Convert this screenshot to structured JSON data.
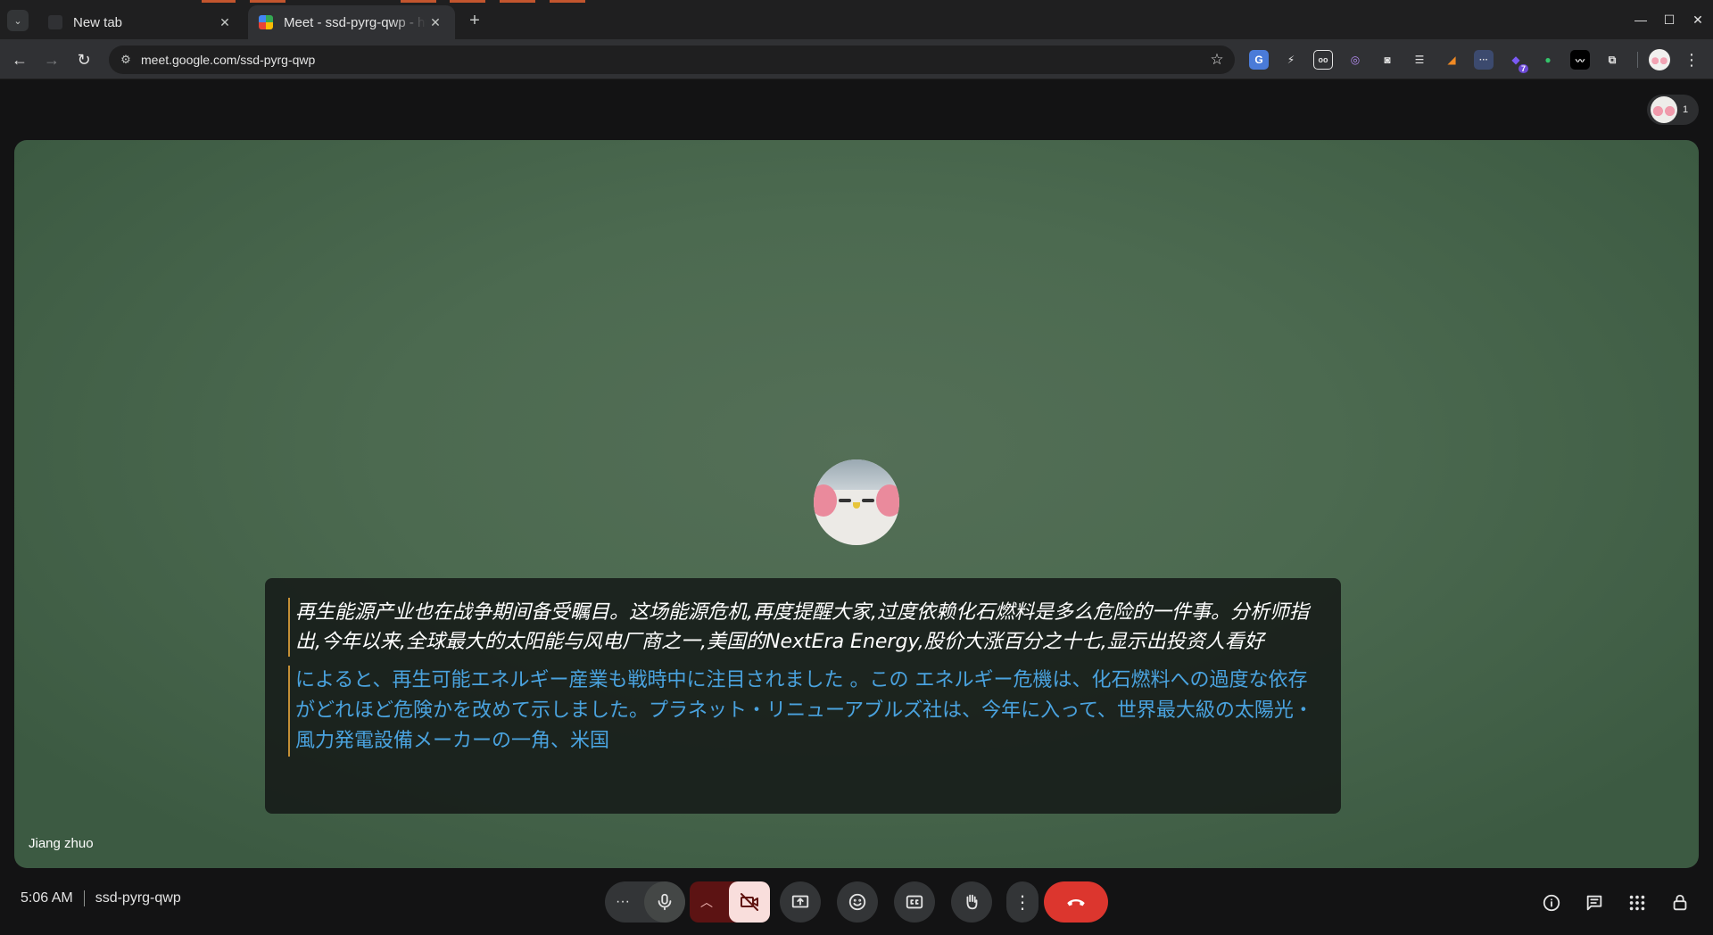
{
  "browser": {
    "tabs": [
      {
        "title": "New tab",
        "active": false
      },
      {
        "title": "Meet - ssd-pyrg-qwp - ht",
        "active": true
      }
    ],
    "url": "meet.google.com/ssd-pyrg-qwp",
    "extension_badge": "7"
  },
  "meet": {
    "participant_count": "1",
    "participant_name": "Jiang zhuo",
    "captions": {
      "chinese": "再生能源产业也在战争期间备受瞩目。这场能源危机,再度提醒大家,过度依赖化石燃料是多么危险的一件事。分析师指出,今年以来,全球最大的太阳能与风电厂商之一,美国的NextEra Energy,股价大涨百分之十七,显示出投资人看好",
      "japanese": "によると、再生可能エネルギー産業も戦時中に注目されました 。この エネルギー危機は、化石燃料への過度な依存がどれほど危険かを改めて示しました。プラネット・リニューアブルズ社は、今年に入って、世界最大級の太陽光・風力発電設備メーカーの一角、米国"
    },
    "time": "5:06 AM",
    "meeting_code": "ssd-pyrg-qwp"
  },
  "colors": {
    "leave_button": "#dc362e",
    "camera_off_bg": "#f9dedc",
    "caption_translation": "#4aa3df",
    "tile_background": "#4c6a50"
  }
}
